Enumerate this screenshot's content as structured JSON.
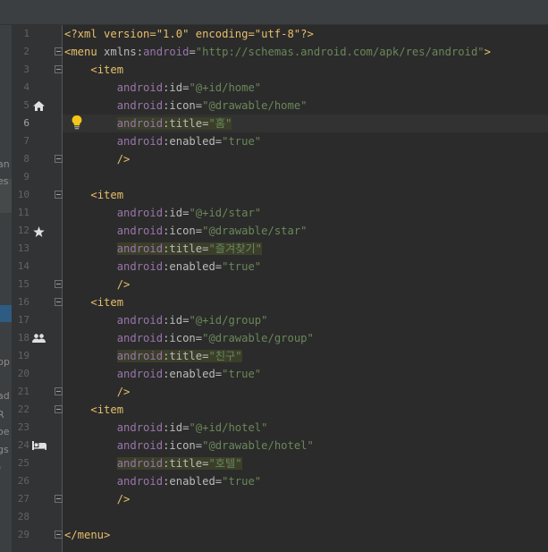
{
  "editor": {
    "line_numbers": [
      "1",
      "2",
      "3",
      "4",
      "5",
      "6",
      "7",
      "8",
      "9",
      "10",
      "11",
      "12",
      "13",
      "14",
      "15",
      "16",
      "17",
      "18",
      "19",
      "20",
      "21",
      "22",
      "23",
      "24",
      "25",
      "26",
      "27",
      "28",
      "29"
    ],
    "current_line": 6,
    "code": {
      "l1_prolog": "<?xml version=\"1.0\" encoding=\"utf-8\"?>",
      "l2_open": "<menu",
      "l2_ns_attr": "xmlns:",
      "l2_ns_name": "android",
      "l2_eq": "=",
      "l2_val": "\"http://schemas.android.com/apk/res/android\"",
      "l2_close": ">",
      "item_open": "<item",
      "android": "android",
      "id_attr": ":id=",
      "icon_attr": ":icon=",
      "title_attr": ":title=",
      "enabled_attr": ":enabled=",
      "self_close": "/>",
      "item1_id": "\"@+id/home\"",
      "item1_icon": "\"@drawable/home\"",
      "item1_title": "\"홈\"",
      "item1_enabled": "\"true\"",
      "item2_id": "\"@+id/star\"",
      "item2_icon": "\"@drawable/star\"",
      "item2_title": "\"즐겨찾기\"",
      "item2_enabled": "\"true\"",
      "item3_id": "\"@+id/group\"",
      "item3_icon": "\"@drawable/group\"",
      "item3_title": "\"친구\"",
      "item3_enabled": "\"true\"",
      "item4_id": "\"@+id/hotel\"",
      "item4_icon": "\"@drawable/hotel\"",
      "item4_title": "\"호텔\"",
      "item4_enabled": "\"true\"",
      "l29_close": "</menu>"
    }
  },
  "left_strip": {
    "fragments": [
      "an",
      "es",
      "pp",
      "ad",
      "R",
      "oe",
      "gs",
      ")"
    ]
  },
  "gutter_icons": [
    "home-icon",
    "lightbulb-icon",
    "star-icon",
    "group-icon",
    "hotel-icon"
  ],
  "colors": {
    "background": "#2b2b2b",
    "tag": "#e8bf6a",
    "namespace": "#9876aa",
    "string": "#6a8759",
    "attribute": "#bababa"
  }
}
